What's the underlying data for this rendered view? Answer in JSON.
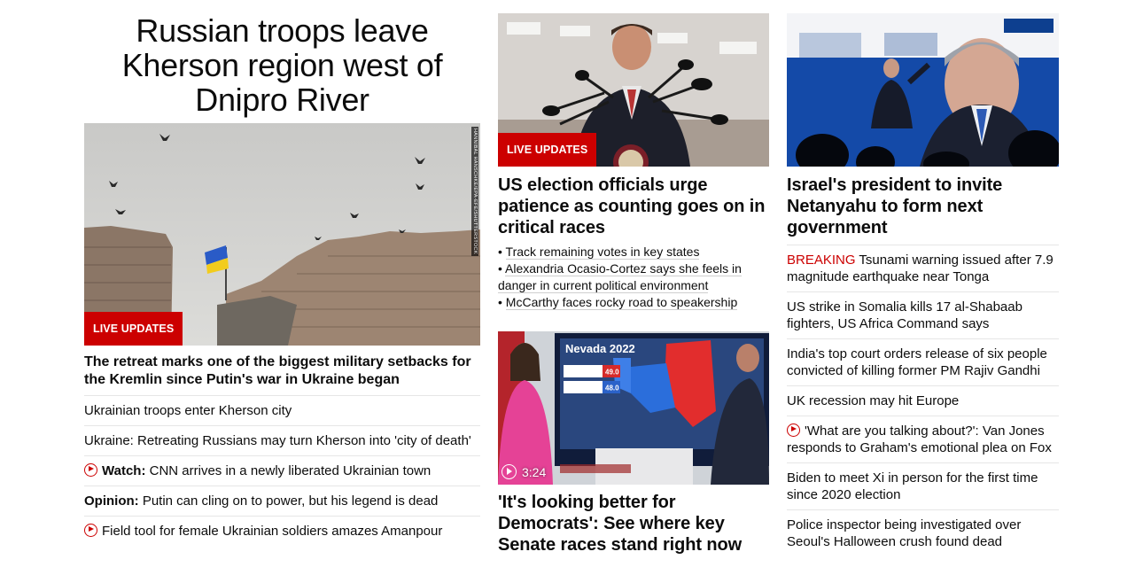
{
  "col1": {
    "headline": "Russian troops leave Kherson region west of Dnipro River",
    "badge": "LIVE UPDATES",
    "credit": "HANNIBAL HANSCHKE/EPA-EFE/SHUTTERSTOCK",
    "lead": "The retreat marks one of the biggest military setbacks for the Kremlin since Putin's war in Ukraine began",
    "items": [
      {
        "prefix": "",
        "text": "Ukrainian troops enter Kherson city",
        "icon": ""
      },
      {
        "prefix": "",
        "text": "Ukraine: Retreating Russians may turn Kherson into 'city of death'",
        "icon": ""
      },
      {
        "prefix": "Watch:",
        "text": " CNN arrives in a newly liberated Ukrainian town",
        "icon": "play-icon"
      },
      {
        "prefix": "Opinion:",
        "text": " Putin can cling on to power, but his legend is dead",
        "icon": ""
      },
      {
        "prefix": "",
        "text": "Field tool for female Ukrainian soldiers amazes Amanpour",
        "icon": "play-icon"
      }
    ]
  },
  "col2": {
    "card1": {
      "badge": "LIVE UPDATES",
      "title": "US election officials urge patience as counting goes on in critical races",
      "bullets": [
        "Track remaining votes in key states",
        "Alexandria Ocasio-Cortez says she feels in danger in current political environment",
        "McCarthy faces rocky road to speakership"
      ]
    },
    "card2": {
      "duration": "3:24",
      "screen_title": "Nevada 2022",
      "v1": "49.0",
      "v2": "48.0",
      "title": "'It's looking better for Democrats': See where key Senate races stand right now"
    }
  },
  "col3": {
    "title": "Israel's president to invite Netanyahu to form next government",
    "items": [
      {
        "label": "BREAKING",
        "text": " Tsunami warning issued after 7.9 magnitude earthquake near Tonga",
        "icon": ""
      },
      {
        "label": "",
        "text": "US strike in Somalia kills 17 al-Shabaab fighters, US Africa Command says",
        "icon": ""
      },
      {
        "label": "",
        "text": "India's top court orders release of six people convicted of killing former PM Rajiv Gandhi",
        "icon": ""
      },
      {
        "label": "",
        "text": "UK recession may hit Europe",
        "icon": ""
      },
      {
        "label": "",
        "text": "'What are you talking about?': Van Jones responds to Graham's emotional plea on Fox",
        "icon": "play-icon"
      },
      {
        "label": "",
        "text": "Biden to meet Xi in person for the first time since 2020 election",
        "icon": ""
      },
      {
        "label": "",
        "text": "Police inspector being investigated over Seoul's Halloween crush found dead",
        "icon": ""
      }
    ]
  },
  "colors": {
    "accent": "#cc0000",
    "text": "#0c0c0c",
    "divider": "#e6e6e6"
  }
}
